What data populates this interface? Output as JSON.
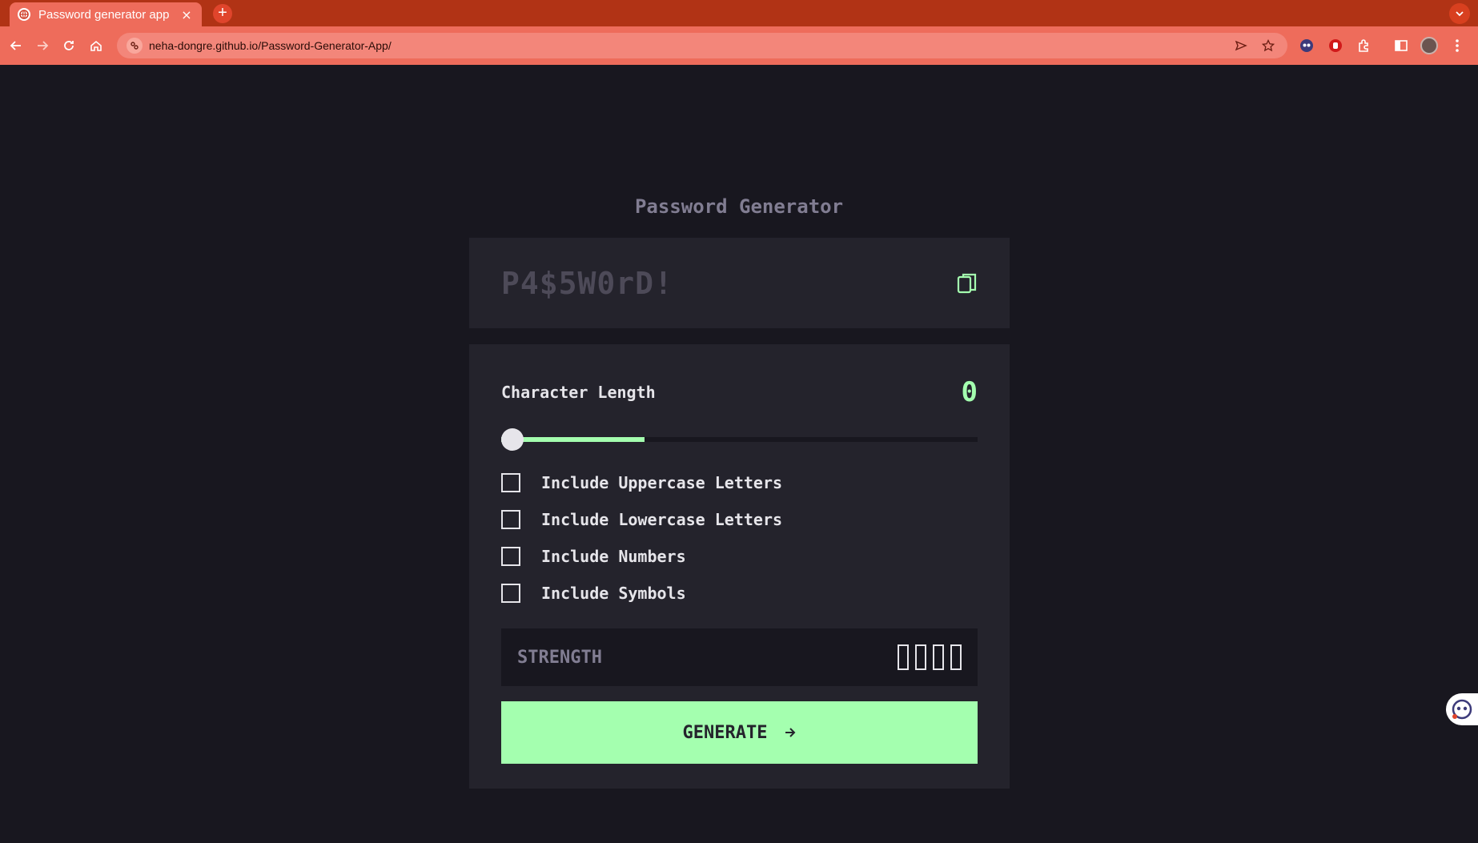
{
  "browser": {
    "tab_title": "Password generator app",
    "tab_close": "×",
    "new_tab": "+",
    "url": "neha-dongre.github.io/Password-Generator-App/"
  },
  "app": {
    "title": "Password Generator",
    "password_placeholder": "P4$5W0rD!",
    "length_label": "Character Length",
    "length_value": "0",
    "slider_level": 0.3,
    "options": [
      {
        "label": "Include Uppercase Letters",
        "checked": false
      },
      {
        "label": "Include Lowercase Letters",
        "checked": false
      },
      {
        "label": "Include Numbers",
        "checked": false
      },
      {
        "label": "Include Symbols",
        "checked": false
      }
    ],
    "strength_label": "STRENGTH",
    "strength_bars_filled": 0,
    "generate_label": "GENERATE"
  },
  "colors": {
    "accent": "#a4ffaf",
    "panel": "#24232c",
    "background": "#18171f",
    "muted": "#817d92",
    "text": "#e6e5ea"
  }
}
